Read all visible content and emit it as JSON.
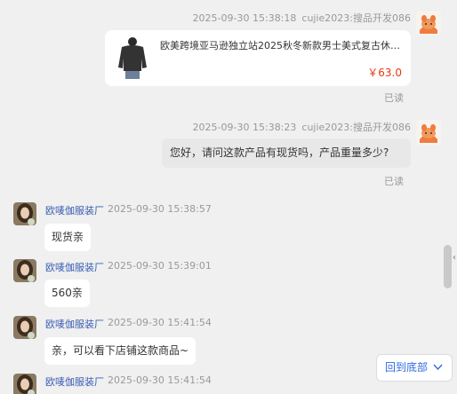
{
  "messages": {
    "m1": {
      "timestamp": "2025-09-30 15:38:18",
      "sender": "cujie2023:搜品开发086",
      "product_title": "欧美跨境亚马逊独立站2025秋冬新款男士美式复古休闲...",
      "product_price": "￥63.0",
      "status": "已读"
    },
    "m2": {
      "timestamp": "2025-09-30 15:38:23",
      "sender": "cujie2023:搜品开发086",
      "text": "您好，请问这款产品有现货吗，产品重量多少?",
      "status": "已读"
    },
    "m3": {
      "sender": "欧唛伽服装厂",
      "timestamp": "2025-09-30 15:38:57",
      "text": "现货亲"
    },
    "m4": {
      "sender": "欧唛伽服装厂",
      "timestamp": "2025-09-30 15:39:01",
      "text": "560亲"
    },
    "m5": {
      "sender": "欧唛伽服装厂",
      "timestamp": "2025-09-30 15:41:54",
      "text": "亲，可以看下店铺这款商品~"
    },
    "m6": {
      "sender": "欧唛伽服装厂",
      "timestamp": "2025-09-30 15:41:54"
    }
  },
  "back_to_bottom": {
    "label": "回到底部",
    "icon": "chevron-down-icon"
  },
  "colors": {
    "price": "#e8390e",
    "link": "#2f6be0",
    "sender_name": "#3a5db3"
  }
}
